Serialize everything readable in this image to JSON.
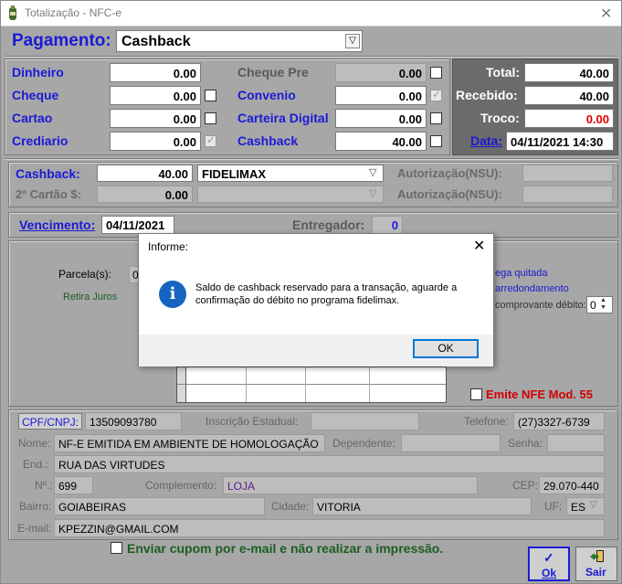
{
  "window": {
    "title": "Totalização - NFC-e",
    "close": "✕"
  },
  "header": {
    "label": "Pagamento:",
    "selected": "Cashback"
  },
  "payments": {
    "dinheiro": {
      "label": "Dinheiro",
      "value": "0.00"
    },
    "cheque": {
      "label": "Cheque",
      "value": "0.00"
    },
    "cartao": {
      "label": "Cartao",
      "value": "0.00"
    },
    "crediario": {
      "label": "Crediario",
      "value": "0.00"
    },
    "cheque_pre": {
      "label": "Cheque Pre",
      "value": "0.00"
    },
    "convenio": {
      "label": "Convenio",
      "value": "0.00"
    },
    "carteira_digital": {
      "label": "Carteira Digital",
      "value": "0.00"
    },
    "cashback": {
      "label": "Cashback",
      "value": "40.00"
    }
  },
  "totals": {
    "total_label": "Total:",
    "total_value": "40.00",
    "recebido_label": "Recebido:",
    "recebido_value": "40.00",
    "troco_label": "Troco:",
    "troco_value": "0.00",
    "data_label": "Data:",
    "data_value": "04/11/2021 14:30"
  },
  "cashback_section": {
    "cashback_label": "Cashback:",
    "cashback_value": "40.00",
    "provider": "FIDELIMAX",
    "autorizacao_label": "Autorização(NSU):",
    "segundo_cartao_label": "2º Cartão $:",
    "segundo_cartao_value": "0.00",
    "autorizacao2_label": "Autorização(NSU):"
  },
  "vencimento": {
    "label": "Vencimento:",
    "value": "04/11/2021",
    "entregador_label": "Entregador:",
    "entregador_value": "0"
  },
  "parcelas": {
    "parcela_label": "Parcela(s):",
    "parcela_value": "0",
    "retira_juros": "Retira Juros",
    "entrega_quitada": "ega quitada",
    "arredondamento": "arredondamento",
    "comprovante_label": "comprovante débito:",
    "comprovante_value": "0"
  },
  "emite_nfe": "Emite NFE Mod. 55",
  "client": {
    "cpf_label": "CPF/CNPJ:",
    "cpf_value": "13509093780",
    "ie_label": "Inscrição Estadual:",
    "ie_value": "",
    "telefone_label": "Telefone:",
    "telefone_value": "(27)3327-6739",
    "nome_label": "Nome:",
    "nome_value": "NF-E EMITIDA EM AMBIENTE DE HOMOLOGAÇÃO",
    "dependente_label": "Dependente:",
    "senha_label": "Senha:",
    "end_label": "End.:",
    "end_value": "RUA DAS VIRTUDES",
    "num_label": "Nº.:",
    "num_value": "699",
    "complemento_label": "Complemento:",
    "complemento_value": "LOJA",
    "cep_label": "CEP:",
    "cep_value": "29.070-440",
    "bairro_label": "Bairro:",
    "bairro_value": "GOIABEIRAS",
    "cidade_label": "Cidade:",
    "cidade_value": "VITORIA",
    "uf_label": "UF:",
    "uf_value": "ES",
    "email_label": "E-mail:",
    "email_value": "KPEZZIN@GMAIL.COM"
  },
  "footer": {
    "email_option": "Enviar cupom por e-mail e não realizar a impressão.",
    "ok_label": "Ok",
    "sair_label": "Sair"
  },
  "dialog": {
    "title": "Informe:",
    "close": "✕",
    "message": "Saldo de cashback reservado para a transação, aguarde a confirmação do débito no programa fidelimax.",
    "ok_label": "OK"
  },
  "colors": {
    "accent_blue": "#1a1ad6",
    "troco_red": "#e00000",
    "panel_dark": "#6b6b6b",
    "dialog_icon": "#1565c0"
  }
}
